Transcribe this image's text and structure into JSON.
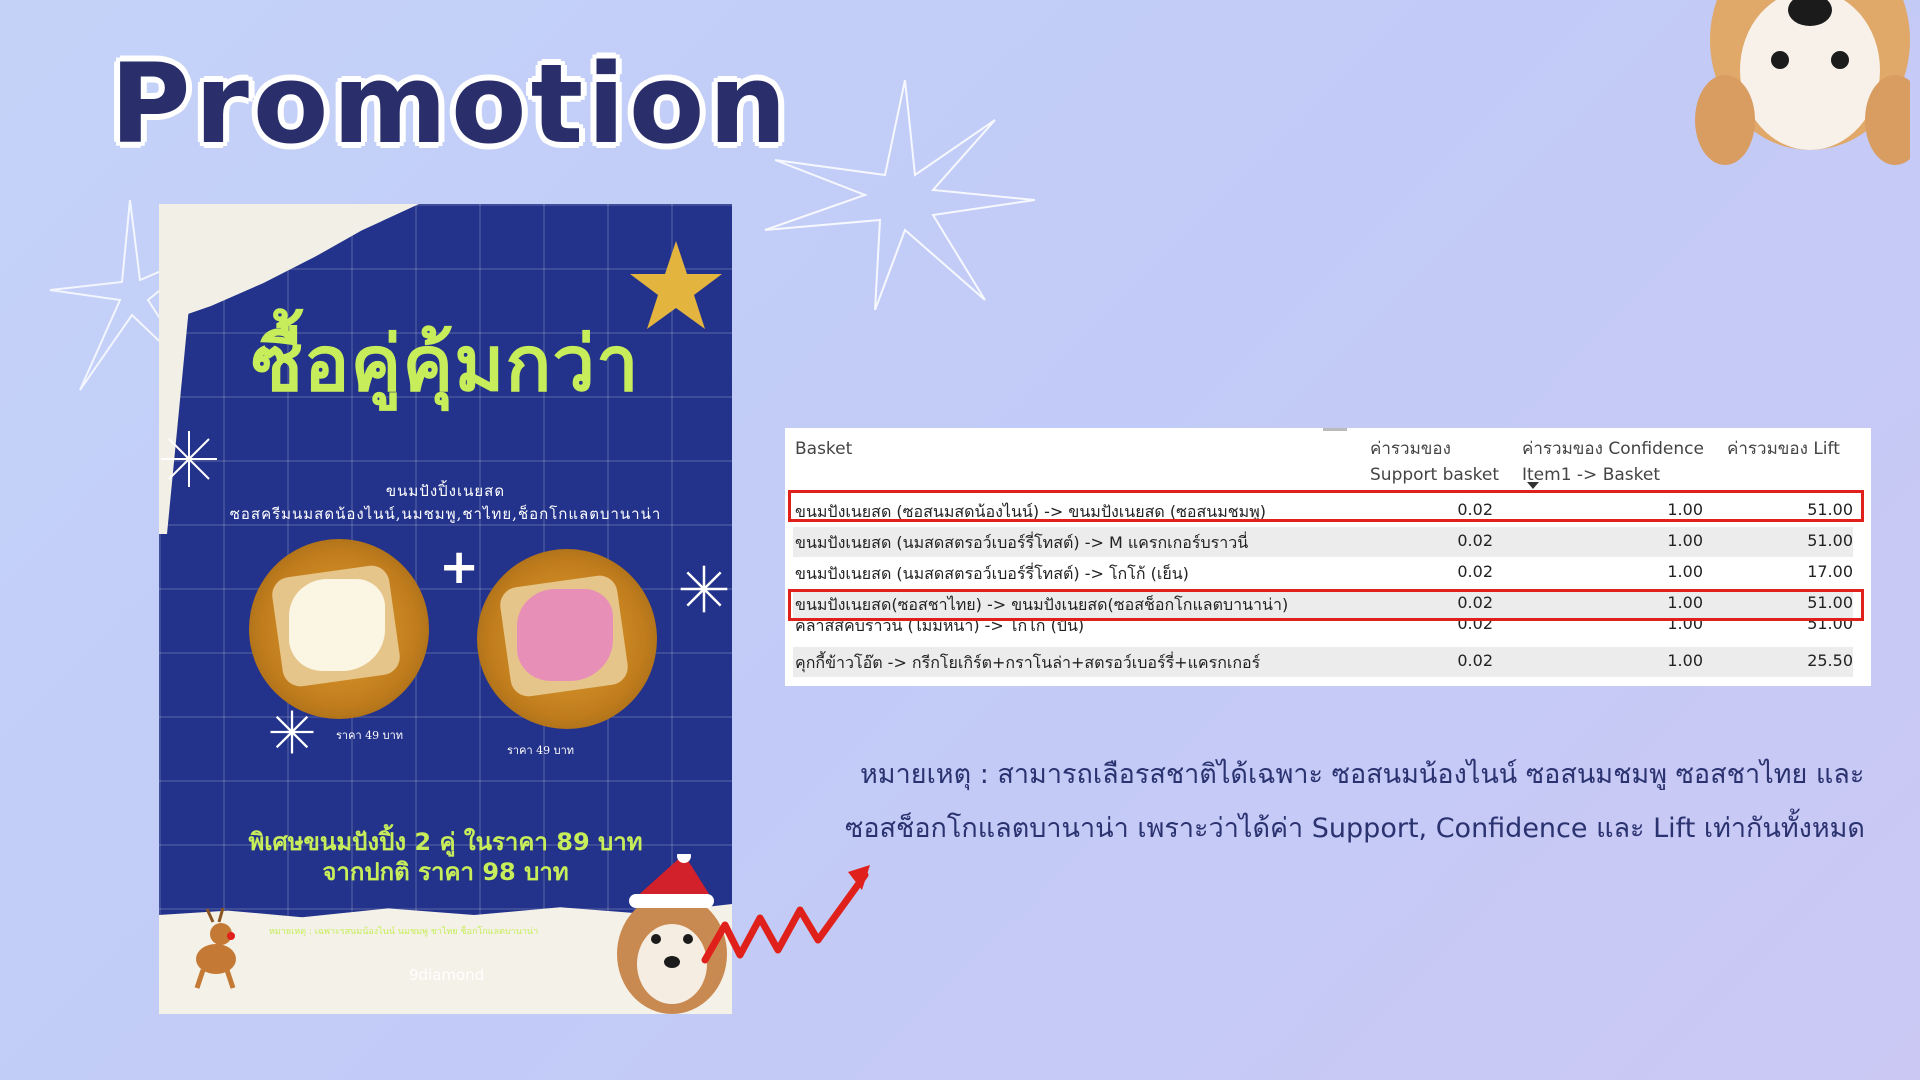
{
  "slide": {
    "title": "Promotion"
  },
  "poster": {
    "headline": "ซื้อคู่คุ้มกว่า",
    "subtitle_line1": "ขนมปังปิ้งเนยสด",
    "subtitle_line2": "ซอสครีมนมสดน้องไนน์,นมชมพู,ชาไทย,ช็อกโกแลตบานาน่า",
    "price_left": "ราคา 49 บาท",
    "price_right": "ราคา 49 บาท",
    "special_line1": "พิเศษขนมปังปิ้ง 2 คู่ ในราคา 89 บาท",
    "special_line2": "จากปกติ ราคา 98 บาท",
    "note": "หมายเหตุ : เฉพาะรสนมน้องไนน์ นมชมพู ชาไทย ช็อกโกแลตบานาน่า",
    "brand": "9diamond"
  },
  "table": {
    "headers": {
      "basket": "Basket",
      "support_l1": "ค่ารวมของ",
      "support_l2": "Support basket",
      "confidence_l1": "ค่ารวมของ Confidence",
      "confidence_l2": "Item1 -> Basket",
      "lift": "ค่ารวมของ Lift"
    },
    "rows": [
      {
        "basket": "ขนมปังเนยสด (ซอสนมสดน้องไนน์) -> ขนมปังเนยสด (ซอสนมชมพู)",
        "support": "0.02",
        "confidence": "1.00",
        "lift": "51.00"
      },
      {
        "basket": "ขนมปังเนยสด (นมสดสตรอว์เบอร์รี่โทสต์) -> M แครกเกอร์บราวนี่",
        "support": "0.02",
        "confidence": "1.00",
        "lift": "51.00"
      },
      {
        "basket": "ขนมปังเนยสด (นมสดสตรอว์เบอร์รี่โทสต์) -> โกโก้ (เย็น)",
        "support": "0.02",
        "confidence": "1.00",
        "lift": "17.00"
      },
      {
        "basket": "ขนมปังเนยสด(ซอสชาไทย) -> ขนมปังเนยสด(ซอสช็อกโกแลตบานาน่า)",
        "support": "0.02",
        "confidence": "1.00",
        "lift": "51.00"
      },
      {
        "basket": "คลาสสิคบราวนี่ (ไม่มีหน้า) -> โกโก้ (ปั่น)",
        "support": "0.02",
        "confidence": "1.00",
        "lift": "51.00"
      },
      {
        "basket": "คุกกี้ข้าวโอ๊ต -> กรีกโยเกิร์ต+กราโนล่า+สตรอว์เบอร์รี่+แครกเกอร์",
        "support": "0.02",
        "confidence": "1.00",
        "lift": "25.50"
      }
    ]
  },
  "remark": {
    "line1": "หมายเหตุ : สามารถเลือรสชาติได้เฉพาะ ซอสนมน้องไนน์ ซอสนมชมพู ซอสชาไทย และ",
    "line2": "ซอสช็อกโกแลตบานาน่า เพราะว่าได้ค่า Support, Confidence และ Lift เท่ากันทั้งหมด"
  },
  "colors": {
    "highlight": "#e0201a",
    "poster_blue": "#23328a",
    "poster_lime": "#c7ee5a",
    "title_navy": "#2a2f6b"
  }
}
